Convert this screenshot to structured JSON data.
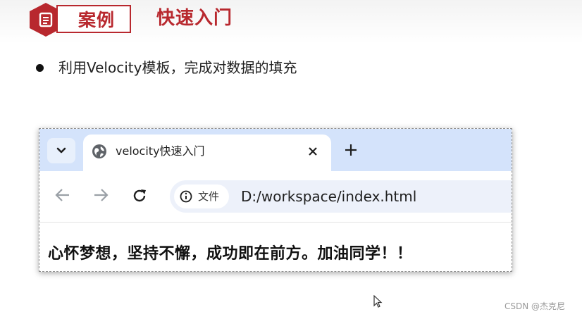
{
  "header": {
    "badge_label": "案例",
    "title": "快速入门"
  },
  "bullet": {
    "text": "利用Velocity模板，完成对数据的填充"
  },
  "browser": {
    "tab_title": "velocity快速入门",
    "site_chip_label": "文件",
    "url": "D:/workspace/index.html",
    "page_content": "心怀梦想，坚持不懈，成功即在前方。加油同学！！"
  },
  "icons": [
    "document-icon",
    "chevron-down-icon",
    "globe-icon",
    "close-icon",
    "plus-icon",
    "back-arrow-icon",
    "forward-arrow-icon",
    "reload-icon",
    "info-icon",
    "mouse-cursor-icon"
  ],
  "colors": {
    "accent": "#b8282e",
    "tabstrip": "#d4e3fb",
    "omnibox": "#edf1fa"
  },
  "watermark": "CSDN @杰克尼"
}
